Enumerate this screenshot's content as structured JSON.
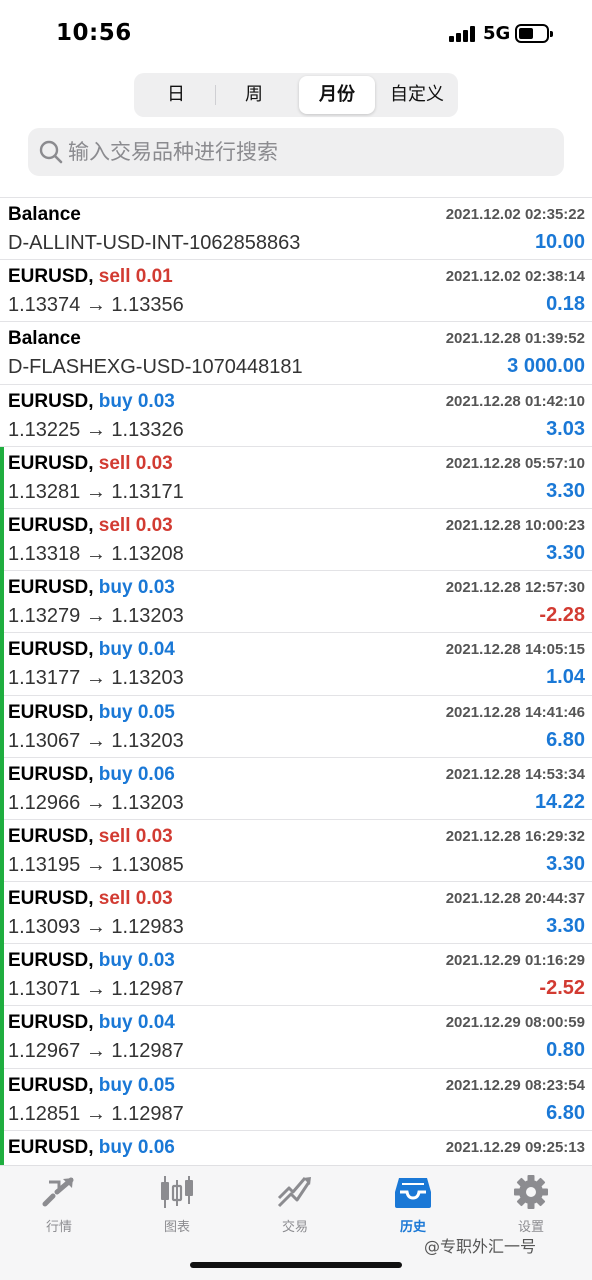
{
  "status_bar": {
    "time": "10:56",
    "network": "5G"
  },
  "period_tabs": [
    {
      "label": "日",
      "active": false
    },
    {
      "label": "周",
      "active": false
    },
    {
      "label": "月份",
      "active": true
    },
    {
      "label": "自定义",
      "active": false
    }
  ],
  "search": {
    "placeholder": "输入交易品种进行搜索"
  },
  "rows": [
    {
      "title": "Balance",
      "side": "",
      "sub": "D-ALLINT-USD-INT-1062858863",
      "time": "2021.12.02 02:35:22",
      "profit": "10.00",
      "profit_sign": "pos",
      "bar": false
    },
    {
      "title": "EURUSD, ",
      "side": "sell 0.01",
      "side_type": "sell",
      "sub": "1.13374 → 1.13356",
      "time": "2021.12.02 02:38:14",
      "profit": "0.18",
      "profit_sign": "pos",
      "bar": false
    },
    {
      "title": "Balance",
      "side": "",
      "sub": "D-FLASHEXG-USD-1070448181",
      "time": "2021.12.28 01:39:52",
      "profit": "3 000.00",
      "profit_sign": "pos",
      "bar": false
    },
    {
      "title": "EURUSD, ",
      "side": "buy 0.03",
      "side_type": "buy",
      "sub": "1.13225 → 1.13326",
      "time": "2021.12.28 01:42:10",
      "profit": "3.03",
      "profit_sign": "pos",
      "bar": false
    },
    {
      "title": "EURUSD, ",
      "side": "sell 0.03",
      "side_type": "sell",
      "sub": "1.13281 → 1.13171",
      "time": "2021.12.28 05:57:10",
      "profit": "3.30",
      "profit_sign": "pos",
      "bar": true
    },
    {
      "title": "EURUSD, ",
      "side": "sell 0.03",
      "side_type": "sell",
      "sub": "1.13318 → 1.13208",
      "time": "2021.12.28 10:00:23",
      "profit": "3.30",
      "profit_sign": "pos",
      "bar": true
    },
    {
      "title": "EURUSD, ",
      "side": "buy 0.03",
      "side_type": "buy",
      "sub": "1.13279 → 1.13203",
      "time": "2021.12.28 12:57:30",
      "profit": "-2.28",
      "profit_sign": "neg",
      "bar": true
    },
    {
      "title": "EURUSD, ",
      "side": "buy 0.04",
      "side_type": "buy",
      "sub": "1.13177 → 1.13203",
      "time": "2021.12.28 14:05:15",
      "profit": "1.04",
      "profit_sign": "pos",
      "bar": true
    },
    {
      "title": "EURUSD, ",
      "side": "buy 0.05",
      "side_type": "buy",
      "sub": "1.13067 → 1.13203",
      "time": "2021.12.28 14:41:46",
      "profit": "6.80",
      "profit_sign": "pos",
      "bar": true
    },
    {
      "title": "EURUSD, ",
      "side": "buy 0.06",
      "side_type": "buy",
      "sub": "1.12966 → 1.13203",
      "time": "2021.12.28 14:53:34",
      "profit": "14.22",
      "profit_sign": "pos",
      "bar": true
    },
    {
      "title": "EURUSD, ",
      "side": "sell 0.03",
      "side_type": "sell",
      "sub": "1.13195 → 1.13085",
      "time": "2021.12.28 16:29:32",
      "profit": "3.30",
      "profit_sign": "pos",
      "bar": true
    },
    {
      "title": "EURUSD, ",
      "side": "sell 0.03",
      "side_type": "sell",
      "sub": "1.13093 → 1.12983",
      "time": "2021.12.28 20:44:37",
      "profit": "3.30",
      "profit_sign": "pos",
      "bar": true
    },
    {
      "title": "EURUSD, ",
      "side": "buy 0.03",
      "side_type": "buy",
      "sub": "1.13071 → 1.12987",
      "time": "2021.12.29 01:16:29",
      "profit": "-2.52",
      "profit_sign": "neg",
      "bar": true
    },
    {
      "title": "EURUSD, ",
      "side": "buy 0.04",
      "side_type": "buy",
      "sub": "1.12967 → 1.12987",
      "time": "2021.12.29 08:00:59",
      "profit": "0.80",
      "profit_sign": "pos",
      "bar": true
    },
    {
      "title": "EURUSD, ",
      "side": "buy 0.05",
      "side_type": "buy",
      "sub": "1.12851 → 1.12987",
      "time": "2021.12.29 08:23:54",
      "profit": "6.80",
      "profit_sign": "pos",
      "bar": true
    },
    {
      "title": "EURUSD, ",
      "side": "buy 0.06",
      "side_type": "buy",
      "sub": "",
      "time": "2021.12.29 09:25:13",
      "profit": "",
      "profit_sign": "pos",
      "bar": true
    }
  ],
  "tabs": [
    {
      "label": "行情",
      "icon": "quotes-icon",
      "active": false
    },
    {
      "label": "图表",
      "icon": "chart-icon",
      "active": false
    },
    {
      "label": "交易",
      "icon": "trade-icon",
      "active": false
    },
    {
      "label": "历史",
      "icon": "history-icon",
      "active": true
    },
    {
      "label": "设置",
      "icon": "gear-icon",
      "active": false
    }
  ],
  "watermark": "@专职外汇一号",
  "colors": {
    "buy": "#1a78d6",
    "sell": "#d23b32",
    "bar": "#1fae3f",
    "active_tab": "#1a78d6"
  }
}
